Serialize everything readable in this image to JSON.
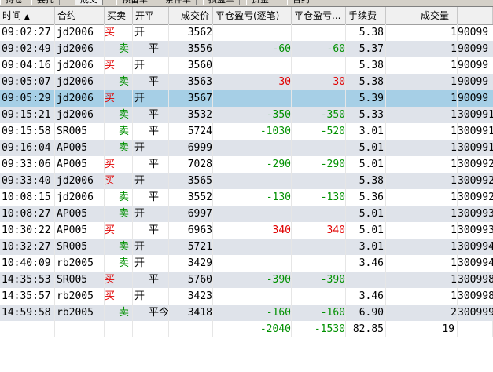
{
  "tabs": [
    {
      "label": "持仓",
      "active": false
    },
    {
      "label": "委托",
      "active": false
    },
    {
      "label": "成交",
      "active": true
    },
    {
      "label": "预备单",
      "active": false
    },
    {
      "label": "条件单",
      "active": false
    },
    {
      "label": "损盈单",
      "active": false
    },
    {
      "label": "资金",
      "active": false
    },
    {
      "label": "合约",
      "active": false
    }
  ],
  "columns": {
    "time": "时间",
    "sort_indicator": "▲",
    "code": "合约",
    "dir": "买卖",
    "oc": "开平",
    "price": "成交价",
    "pnl_single": "平仓盈亏(逐笔)",
    "pnl_cum": "平仓盈亏...",
    "fee": "手续费",
    "qty": "成交量",
    "no": ""
  },
  "rows": [
    {
      "time": "09:02:27",
      "code": "jd2006",
      "dir": "买",
      "oc": "开",
      "price": "3562",
      "pnl1": "",
      "pnl2": "",
      "fee": "5.38",
      "qty": "1",
      "no": "90099"
    },
    {
      "time": "09:02:49",
      "code": "jd2006",
      "dir": "卖",
      "oc": "平",
      "price": "3556",
      "pnl1": "-60",
      "pnl2": "-60",
      "fee": "5.37",
      "qty": "1",
      "no": "90099"
    },
    {
      "time": "09:04:16",
      "code": "jd2006",
      "dir": "买",
      "oc": "开",
      "price": "3560",
      "pnl1": "",
      "pnl2": "",
      "fee": "5.38",
      "qty": "1",
      "no": "90099"
    },
    {
      "time": "09:05:07",
      "code": "jd2006",
      "dir": "卖",
      "oc": "平",
      "price": "3563",
      "pnl1": "30",
      "pnl2": "30",
      "fee": "5.38",
      "qty": "1",
      "no": "90099"
    },
    {
      "time": "09:05:29",
      "code": "jd2006",
      "dir": "买",
      "oc": "开",
      "price": "3567",
      "pnl1": "",
      "pnl2": "",
      "fee": "5.39",
      "qty": "1",
      "no": "90099"
    },
    {
      "time": "09:15:21",
      "code": "jd2006",
      "dir": "卖",
      "oc": "平",
      "price": "3532",
      "pnl1": "-350",
      "pnl2": "-350",
      "fee": "5.33",
      "qty": "1",
      "no": "300991"
    },
    {
      "time": "09:15:58",
      "code": "SR005",
      "dir": "卖",
      "oc": "平",
      "price": "5724",
      "pnl1": "-1030",
      "pnl2": "-520",
      "fee": "3.01",
      "qty": "1",
      "no": "300991"
    },
    {
      "time": "09:16:04",
      "code": "AP005",
      "dir": "卖",
      "oc": "开",
      "price": "6999",
      "pnl1": "",
      "pnl2": "",
      "fee": "5.01",
      "qty": "1",
      "no": "300991"
    },
    {
      "time": "09:33:06",
      "code": "AP005",
      "dir": "买",
      "oc": "平",
      "price": "7028",
      "pnl1": "-290",
      "pnl2": "-290",
      "fee": "5.01",
      "qty": "1",
      "no": "300992"
    },
    {
      "time": "09:33:40",
      "code": "jd2006",
      "dir": "买",
      "oc": "开",
      "price": "3565",
      "pnl1": "",
      "pnl2": "",
      "fee": "5.38",
      "qty": "1",
      "no": "300992"
    },
    {
      "time": "10:08:15",
      "code": "jd2006",
      "dir": "卖",
      "oc": "平",
      "price": "3552",
      "pnl1": "-130",
      "pnl2": "-130",
      "fee": "5.36",
      "qty": "1",
      "no": "300992"
    },
    {
      "time": "10:08:27",
      "code": "AP005",
      "dir": "卖",
      "oc": "开",
      "price": "6997",
      "pnl1": "",
      "pnl2": "",
      "fee": "5.01",
      "qty": "1",
      "no": "300993"
    },
    {
      "time": "10:30:22",
      "code": "AP005",
      "dir": "买",
      "oc": "平",
      "price": "6963",
      "pnl1": "340",
      "pnl2": "340",
      "fee": "5.01",
      "qty": "1",
      "no": "300993"
    },
    {
      "time": "10:32:27",
      "code": "SR005",
      "dir": "卖",
      "oc": "开",
      "price": "5721",
      "pnl1": "",
      "pnl2": "",
      "fee": "3.01",
      "qty": "1",
      "no": "300994"
    },
    {
      "time": "10:40:09",
      "code": "rb2005",
      "dir": "卖",
      "oc": "开",
      "price": "3429",
      "pnl1": "",
      "pnl2": "",
      "fee": "3.46",
      "qty": "1",
      "no": "300994"
    },
    {
      "time": "14:35:53",
      "code": "SR005",
      "dir": "买",
      "oc": "平",
      "price": "5760",
      "pnl1": "-390",
      "pnl2": "-390",
      "fee": "",
      "qty": "1",
      "no": "300998"
    },
    {
      "time": "14:35:57",
      "code": "rb2005",
      "dir": "买",
      "oc": "开",
      "price": "3423",
      "pnl1": "",
      "pnl2": "",
      "fee": "3.46",
      "qty": "1",
      "no": "300998"
    },
    {
      "time": "14:59:58",
      "code": "rb2005",
      "dir": "卖",
      "oc": "平今",
      "price": "3418",
      "pnl1": "-160",
      "pnl2": "-160",
      "fee": "6.90",
      "qty": "2",
      "no": "300999"
    }
  ],
  "selected_index": 4,
  "totals": {
    "pnl1": "-2040",
    "pnl2": "-1530",
    "fee": "82.85",
    "qty": "19"
  },
  "colors": {
    "buy": "#e00000",
    "sell": "#009000",
    "selected": "#a6cfe6",
    "alt_row": "#dfe3ea"
  }
}
